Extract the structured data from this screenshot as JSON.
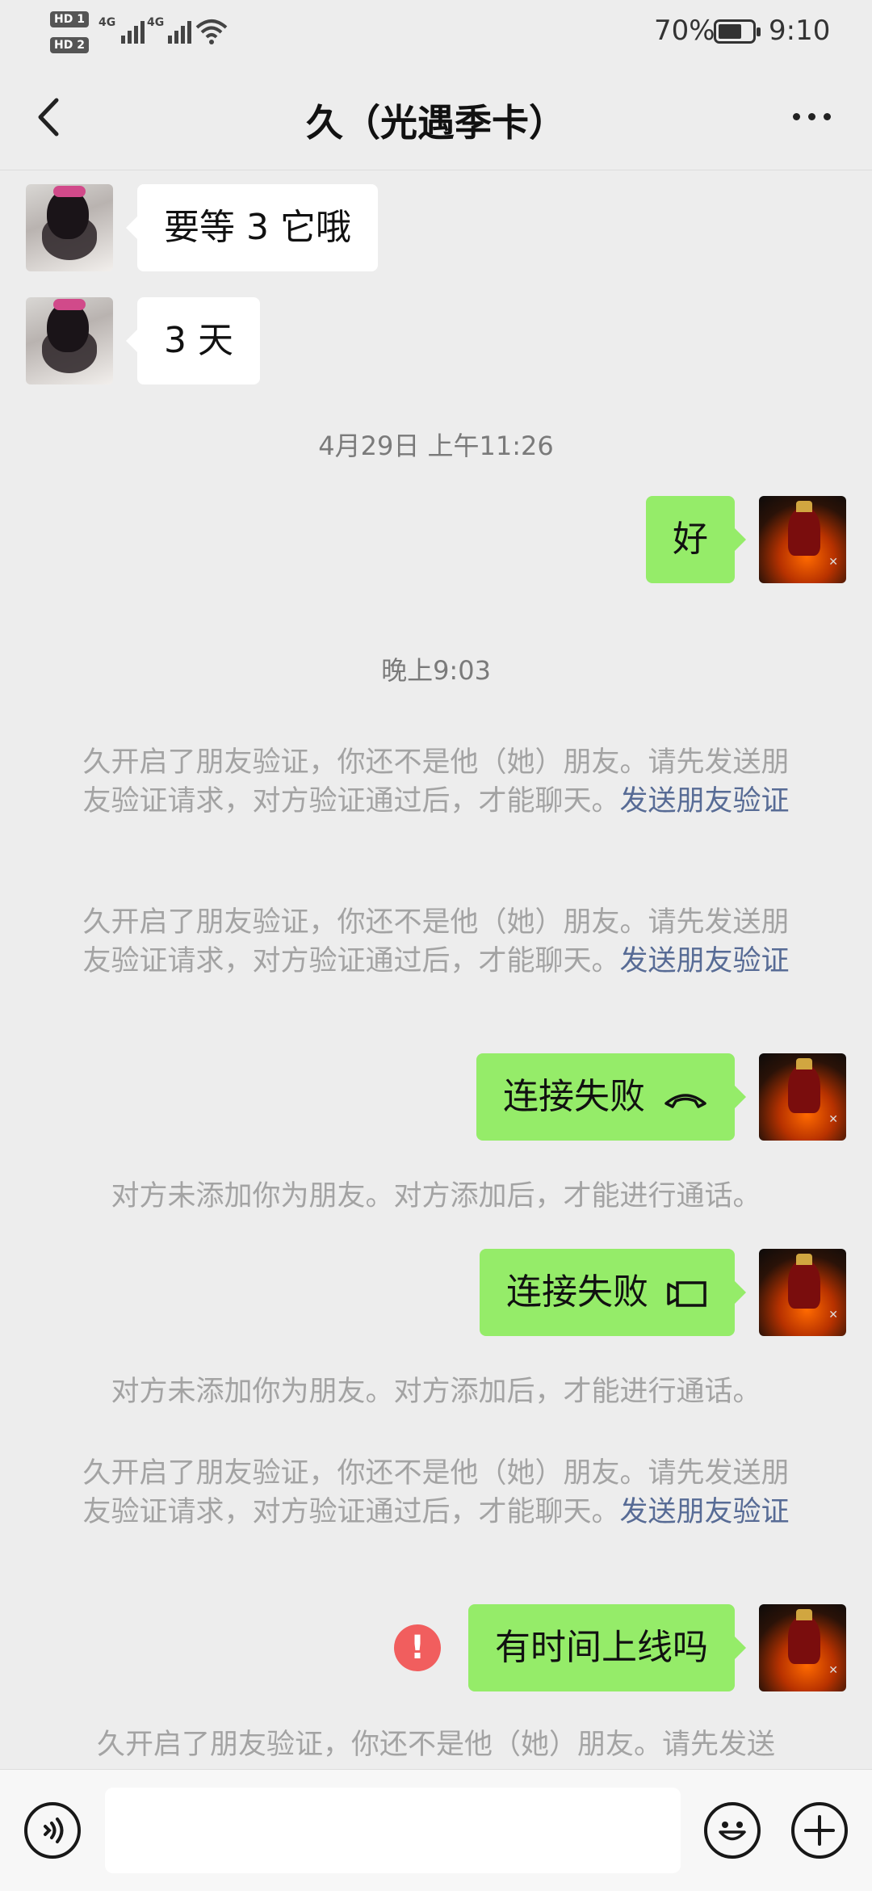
{
  "status_bar": {
    "hd1": "HD 1",
    "hd2": "HD 2",
    "net1": "4G",
    "net2": "4G",
    "battery_text": "70%",
    "battery_level": 0.7,
    "time": "9:10"
  },
  "header": {
    "title": "久（光遇季卡）",
    "back_icon": "chevron-left-icon",
    "more_icon": "more-dots-icon"
  },
  "messages": {
    "m1": "要等 3 它哦",
    "m2": "3 天",
    "ts1": "4月29日 上午11:26",
    "m3": "好",
    "ts2": "晚上9:03",
    "sys1_text": "久开启了朋友验证，你还不是他（她）朋友。请先发送朋友验证请求，对方验证通过后，才能聊天。",
    "sys1_link": "发送朋友验证",
    "sys2_text": "久开启了朋友验证，你还不是他（她）朋友。请先发送朋友验证请求，对方验证通过后，才能聊天。",
    "sys2_link": "发送朋友验证",
    "m4": "连接失败",
    "m4_icon": "phone-hangup-icon",
    "sys3": "对方未添加你为朋友。对方添加后，才能进行通话。",
    "m5": "连接失败",
    "m5_icon": "video-call-icon",
    "sys4": "对方未添加你为朋友。对方添加后，才能进行通话。",
    "sys5_text": "久开启了朋友验证，你还不是他（她）朋友。请先发送朋友验证请求，对方验证通过后，才能聊天。",
    "sys5_link": "发送朋友验证",
    "m6": "有时间上线吗",
    "m6_error": "!",
    "sys6": "久开启了朋友验证，你还不是他（她）朋友。请先发送"
  },
  "input_bar": {
    "voice_icon": "voice-icon",
    "emoji_icon": "emoji-icon",
    "plus_icon": "plus-icon"
  }
}
